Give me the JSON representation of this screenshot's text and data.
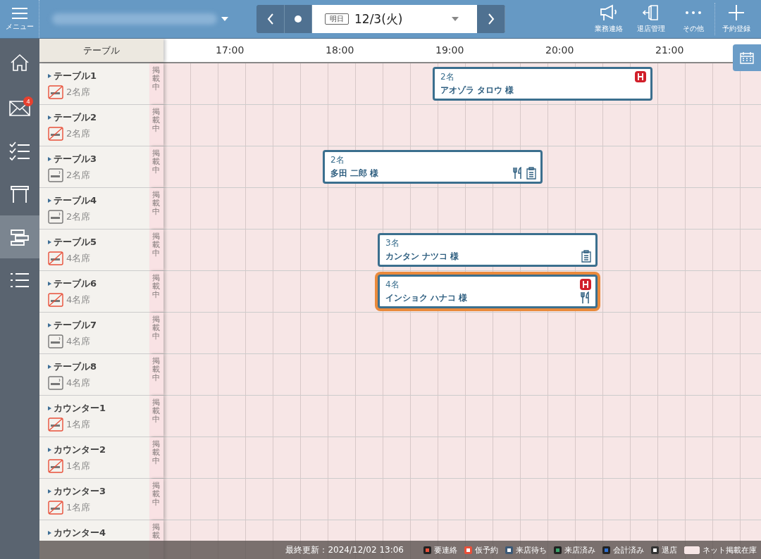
{
  "header": {
    "menu_label": "メニュー",
    "date_tag": "明日",
    "date": "12/3(火)",
    "actions": [
      {
        "kind": "megaphone",
        "label": "業務連絡"
      },
      {
        "kind": "door",
        "label": "退店管理"
      },
      {
        "kind": "dots",
        "label": "その他"
      },
      {
        "kind": "plus",
        "label": "予約登録"
      }
    ]
  },
  "sidebar": {
    "items": [
      {
        "kind": "home",
        "selected": false
      },
      {
        "kind": "mail",
        "selected": false,
        "badge": "4"
      },
      {
        "kind": "checklist",
        "selected": false
      },
      {
        "kind": "table",
        "selected": false
      },
      {
        "kind": "timeline",
        "selected": true
      },
      {
        "kind": "list",
        "selected": false
      }
    ]
  },
  "grid": {
    "column_heading": "テーブル",
    "hours": [
      "17:00",
      "18:00",
      "19:00",
      "20:00",
      "21:00"
    ],
    "rows": [
      {
        "name": "テーブル1",
        "seats": "2名席",
        "smoking": false,
        "listing": "掲載中",
        "reservation": {
          "party": "2名",
          "guest": "アオゾラ タロウ 様",
          "selected": false,
          "course": true,
          "meal": false,
          "memo": false
        }
      },
      {
        "name": "テーブル2",
        "seats": "2名席",
        "smoking": false,
        "listing": "掲載中"
      },
      {
        "name": "テーブル3",
        "seats": "2名席",
        "smoking": true,
        "listing": "掲載中",
        "reservation": {
          "party": "2名",
          "guest": "多田 二郎 様",
          "selected": false,
          "course": false,
          "meal": true,
          "memo": true
        }
      },
      {
        "name": "テーブル4",
        "seats": "2名席",
        "smoking": true,
        "listing": "掲載中"
      },
      {
        "name": "テーブル5",
        "seats": "4名席",
        "smoking": false,
        "listing": "掲載中",
        "reservation": {
          "party": "3名",
          "guest": "カンタン ナツコ 様",
          "selected": false,
          "course": false,
          "meal": false,
          "memo": true
        }
      },
      {
        "name": "テーブル6",
        "seats": "4名席",
        "smoking": false,
        "listing": "掲載中",
        "reservation": {
          "party": "4名",
          "guest": "インショク ハナコ 様",
          "selected": true,
          "course": true,
          "meal": true,
          "memo": false
        }
      },
      {
        "name": "テーブル7",
        "seats": "4名席",
        "smoking": true,
        "listing": "掲載中"
      },
      {
        "name": "テーブル8",
        "seats": "4名席",
        "smoking": true,
        "listing": "掲載中"
      },
      {
        "name": "カウンター1",
        "seats": "1名席",
        "smoking": false,
        "listing": "掲載中"
      },
      {
        "name": "カウンター2",
        "seats": "1名席",
        "smoking": false,
        "listing": "掲載中"
      },
      {
        "name": "カウンター3",
        "seats": "1名席",
        "smoking": false,
        "listing": "掲載中"
      },
      {
        "name": "カウンター4",
        "listing": "掲載"
      }
    ]
  },
  "status_bar": {
    "last_updated": "最終更新：2024/12/02 13:06",
    "legend": [
      {
        "kind": "solid",
        "label": "要連絡",
        "color": "#e8503a"
      },
      {
        "kind": "outline",
        "label": "仮予約",
        "color": "#e8503a"
      },
      {
        "kind": "outline",
        "label": "来店待ち",
        "color": "#3c5a78"
      },
      {
        "kind": "solid",
        "label": "来店済み",
        "color": "#3aa26a"
      },
      {
        "kind": "solid",
        "label": "会計済み",
        "color": "#2f6fd0"
      },
      {
        "kind": "outline",
        "label": "退店",
        "color": "#333333"
      },
      {
        "kind": "swatch",
        "label": "ネット掲載在庫",
        "color": "#f7e6e6"
      }
    ]
  }
}
